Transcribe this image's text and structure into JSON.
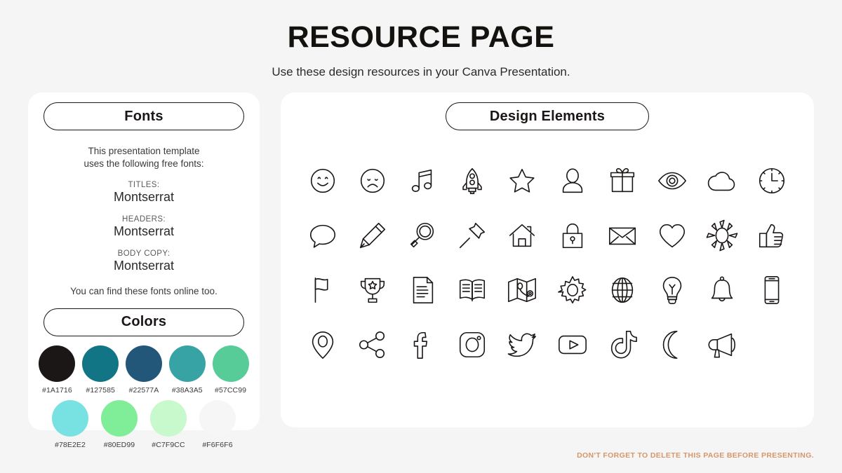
{
  "header": {
    "title": "RESOURCE PAGE",
    "subtitle": "Use these design resources in your Canva Presentation."
  },
  "fonts_panel": {
    "heading": "Fonts",
    "intro_line1": "This presentation template",
    "intro_line2": "uses the following free fonts:",
    "entries": [
      {
        "role": "TITLES:",
        "name": "Montserrat"
      },
      {
        "role": "HEADERS:",
        "name": "Montserrat"
      },
      {
        "role": "BODY COPY:",
        "name": "Montserrat"
      }
    ],
    "outro": "You can find these fonts online too."
  },
  "colors_panel": {
    "heading": "Colors",
    "row1": [
      {
        "hex": "#1A1716",
        "label": "#1A1716"
      },
      {
        "hex": "#127585",
        "label": "#127585"
      },
      {
        "hex": "#22577A",
        "label": "#22577A"
      },
      {
        "hex": "#38A3A5",
        "label": "#38A3A5"
      },
      {
        "hex": "#57CC99",
        "label": "#57CC99"
      }
    ],
    "row2": [
      {
        "hex": "#78E2E2",
        "label": "#78E2E2"
      },
      {
        "hex": "#80ED99",
        "label": "#80ED99"
      },
      {
        "hex": "#C7F9CC",
        "label": "#C7F9CC"
      },
      {
        "hex": "#F6F6F6",
        "label": "#F6F6F6"
      }
    ]
  },
  "elements_panel": {
    "heading": "Design Elements",
    "icons": [
      "smiley-face-icon",
      "sad-face-icon",
      "music-note-icon",
      "rocket-icon",
      "star-icon",
      "person-icon",
      "gift-icon",
      "eye-icon",
      "cloud-icon",
      "clock-icon",
      "speech-bubble-icon",
      "pencil-icon",
      "magnifier-icon",
      "pushpin-icon",
      "house-icon",
      "lock-icon",
      "envelope-icon",
      "heart-icon",
      "sun-icon",
      "thumbs-up-icon",
      "flag-icon",
      "trophy-icon",
      "document-icon",
      "open-book-icon",
      "map-icon",
      "gear-icon",
      "globe-icon",
      "lightbulb-icon",
      "bell-icon",
      "phone-icon",
      "location-pin-icon",
      "share-icon",
      "facebook-icon",
      "instagram-icon",
      "twitter-icon",
      "youtube-icon",
      "tiktok-icon",
      "moon-icon",
      "megaphone-icon"
    ]
  },
  "footer": {
    "note": "DON'T FORGET TO DELETE THIS PAGE BEFORE PRESENTING."
  }
}
